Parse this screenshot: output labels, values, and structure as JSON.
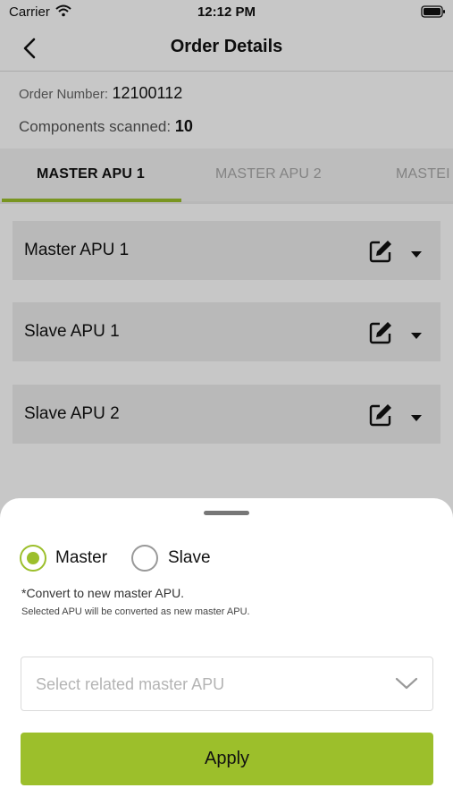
{
  "status_bar": {
    "carrier": "Carrier",
    "time": "12:12 PM"
  },
  "nav": {
    "title": "Order Details"
  },
  "order": {
    "number_label": "Order Number:",
    "number_value": "12100112",
    "components_label": "Components scanned:",
    "components_value": "10"
  },
  "tabs": [
    {
      "label": "MASTER APU 1",
      "active": true
    },
    {
      "label": "MASTER APU 2",
      "active": false
    },
    {
      "label": "MASTEI",
      "active": false
    }
  ],
  "accordion": [
    {
      "label": "Master APU 1",
      "icons": [
        "edit-icon",
        "caret-down-icon"
      ]
    },
    {
      "label": "Slave APU 1",
      "icons": [
        "edit-icon",
        "caret-down-icon"
      ]
    },
    {
      "label": "Slave APU 2",
      "icons": [
        "edit-icon",
        "caret-down-icon"
      ]
    }
  ],
  "sheet": {
    "options": [
      {
        "label": "Master",
        "selected": true
      },
      {
        "label": "Slave",
        "selected": false
      }
    ],
    "note": "*Convert to new master APU.",
    "subnote": "Selected APU will be converted as new master APU.",
    "select_placeholder": "Select related master APU",
    "apply_label": "Apply"
  },
  "colors": {
    "accent": "#9cbf2b",
    "accordion_bg": "#ededed",
    "tab_bg": "#f2f2f2"
  }
}
